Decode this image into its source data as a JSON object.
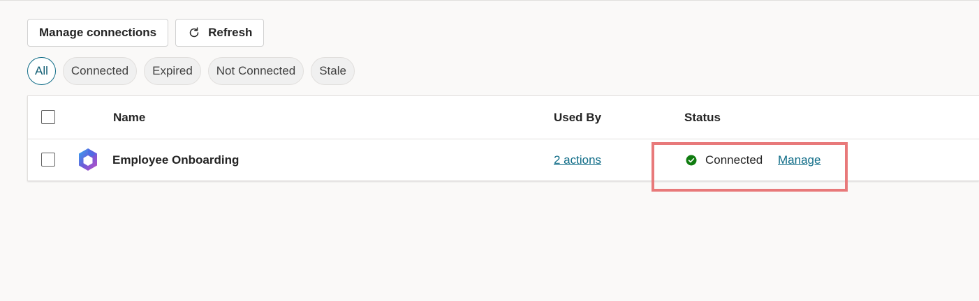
{
  "toolbar": {
    "manage_connections_label": "Manage connections",
    "refresh_label": "Refresh",
    "refresh_icon": "refresh-icon"
  },
  "filters": [
    {
      "label": "All",
      "active": true
    },
    {
      "label": "Connected",
      "active": false
    },
    {
      "label": "Expired",
      "active": false
    },
    {
      "label": "Not Connected",
      "active": false
    },
    {
      "label": "Stale",
      "active": false
    }
  ],
  "table": {
    "columns": {
      "name": "Name",
      "used_by": "Used By",
      "status": "Status"
    },
    "rows": [
      {
        "icon": "microsoft-365-icon",
        "name": "Employee Onboarding",
        "used_by": "2 actions",
        "status": "Connected",
        "status_color": "#107c10",
        "action": "Manage"
      }
    ]
  },
  "colors": {
    "accent": "#0f6c87",
    "highlight": "#e8797a",
    "status_ok": "#107c10"
  }
}
